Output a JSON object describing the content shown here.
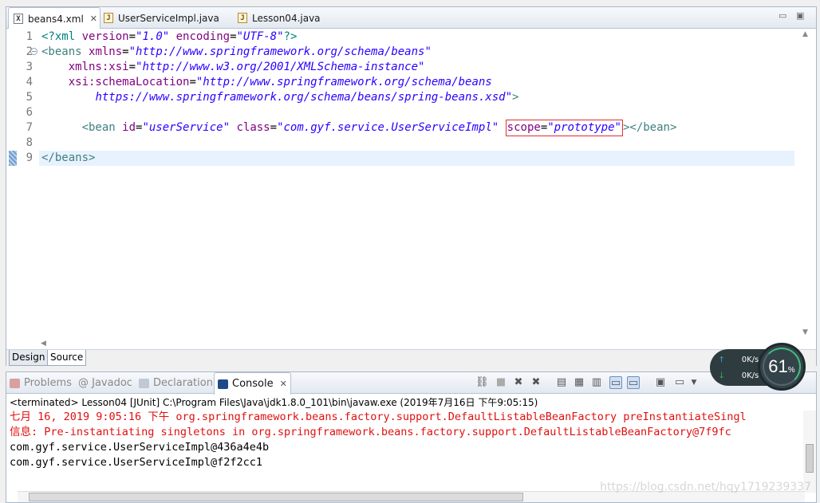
{
  "editor": {
    "tabs": [
      {
        "label": "beans4.xml",
        "icon": "xml-file-icon",
        "close": "✕"
      },
      {
        "label": "UserServiceImpl.java",
        "icon": "java-file-icon"
      },
      {
        "label": "Lesson04.java",
        "icon": "java-file-icon"
      }
    ],
    "line_numbers": [
      "1",
      "2",
      "3",
      "4",
      "5",
      "6",
      "7",
      "8",
      "9"
    ],
    "code": {
      "l1": {
        "pi_open": "<?xml ",
        "a1": "version",
        "eq1": "=",
        "v1": "\"1.0\"",
        "sp": " ",
        "a2": "encoding",
        "eq2": "=",
        "v2": "\"UTF-8\"",
        "pi_close": "?>"
      },
      "l2": {
        "tag": "<beans ",
        "attr": "xmlns",
        "eq": "=",
        "val": "\"http://www.springframework.org/schema/beans\""
      },
      "l3": {
        "indent": "    ",
        "attr": "xmlns:xsi",
        "eq": "=",
        "val": "\"http://www.w3.org/2001/XMLSchema-instance\""
      },
      "l4": {
        "indent": "    ",
        "attr": "xsi:schemaLocation",
        "eq": "=",
        "val": "\"http://www.springframework.org/schema/beans"
      },
      "l5": {
        "indent": "        ",
        "val": "https://www.springframework.org/schema/beans/spring-beans.xsd\"",
        "tag": ">"
      },
      "l7": {
        "indent": "      ",
        "tag": "<bean ",
        "a1": "id",
        "eq1": "=",
        "v1": "\"userService\"",
        "sp1": " ",
        "a2": "class",
        "eq2": "=",
        "v2": "\"com.gyf.service.UserServiceImpl\"",
        "sp2": " ",
        "a3": "scope",
        "eq3": "=",
        "v3": "\"prototype\"",
        "tag_end": "></bean>"
      },
      "l9": {
        "tag": "</beans>"
      }
    },
    "bottom_tabs": [
      "Design",
      "Source"
    ],
    "active_bottom_tab": "Source"
  },
  "console": {
    "tabs": [
      {
        "label": "Problems",
        "icon": "problems-icon"
      },
      {
        "label": "@ Javadoc",
        "icon": "javadoc-icon"
      },
      {
        "label": "Declaration",
        "icon": "declaration-icon"
      },
      {
        "label": "Console",
        "icon": "console-icon",
        "close": "✕"
      }
    ],
    "terminated": "<terminated> Lesson04 [JUnit] C:\\Program Files\\Java\\jdk1.8.0_101\\bin\\javaw.exe (2019年7月16日 下午9:05:15)",
    "lines": [
      {
        "text": "七月 16, 2019 9:05:16 下午 org.springframework.beans.factory.support.DefaultListableBeanFactory preInstantiateSingl",
        "color": "#e01010"
      },
      {
        "text": "信息: Pre-instantiating singletons in org.springframework.beans.factory.support.DefaultListableBeanFactory@7f9fc",
        "color": "#e01010"
      },
      {
        "text": "com.gyf.service.UserServiceImpl@436a4e4b",
        "color": "#000000"
      },
      {
        "text": "com.gyf.service.UserServiceImpl@f2f2cc1",
        "color": "#000000"
      }
    ],
    "watermark": "https://blog.csdn.net/hqy1719239337"
  },
  "net_widget": {
    "up": "0K/s",
    "down": "0K/s",
    "percent": "61",
    "percent_unit": "%"
  }
}
